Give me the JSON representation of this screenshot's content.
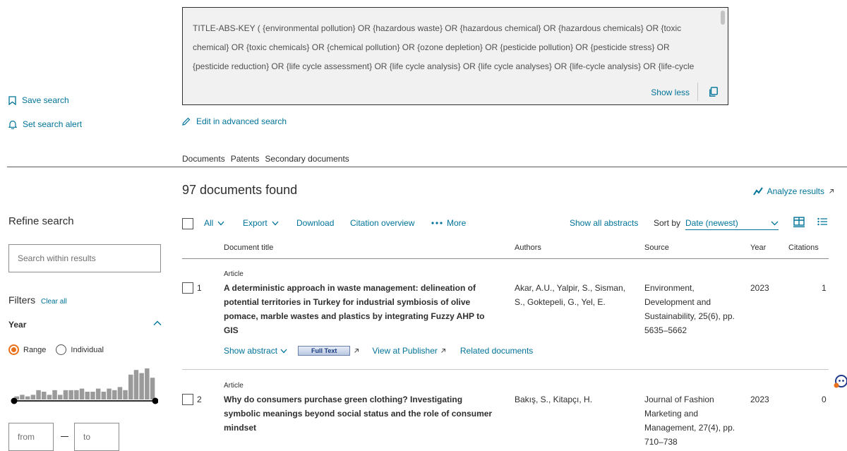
{
  "query": {
    "text": "TITLE-ABS-KEY ( {environmental pollution} OR {hazardous waste} OR {hazardous chemical} OR {hazardous chemicals} OR {toxic chemical} OR {toxic chemicals} OR {chemical pollution} OR {ozone depletion} OR {pesticide pollution} OR {pesticide stress} OR {pesticide reduction} OR {life cycle assessment} OR {life cycle analysis} OR {life cycle analyses} OR {life-cycle analysis} OR {life-cycle",
    "show_less": "Show less",
    "edit_label": "Edit in advanced search"
  },
  "sidebar": {
    "save_search": "Save search",
    "set_alert": "Set search alert",
    "refine_title": "Refine search",
    "search_placeholder": "Search within results",
    "filters_title": "Filters",
    "clear_all": "Clear all",
    "year_label": "Year",
    "range_label": "Range",
    "individual_label": "Individual",
    "histogram_values": [
      1,
      1.5,
      1,
      1.5,
      3,
      2.5,
      1.5,
      3,
      1.5,
      3,
      3,
      3,
      3.5,
      2.5,
      2.5,
      3.5,
      2.5,
      3.5,
      3,
      4,
      3,
      8,
      9.5,
      8.5,
      10,
      7
    ],
    "from_placeholder": "from",
    "to_placeholder": "to"
  },
  "tabs": [
    "Documents",
    "Patents",
    "Secondary documents"
  ],
  "results": {
    "count_label": "97 documents found",
    "analyze": "Analyze results",
    "toolbar": {
      "all": "All",
      "export": "Export",
      "download": "Download",
      "citation_overview": "Citation overview",
      "more": "More",
      "show_all_abstracts": "Show all abstracts",
      "sort_by": "Sort by",
      "sort_value": "Date (newest)"
    },
    "columns": {
      "title": "Document title",
      "authors": "Authors",
      "source": "Source",
      "year": "Year",
      "citations": "Citations"
    },
    "rows": [
      {
        "num": "1",
        "type": "Article",
        "title": "A deterministic approach in waste management: delineation of potential territories in Turkey for industrial symbiosis of olive pomace, marble wastes and plastics by integrating Fuzzy AHP to GIS",
        "authors": "Akar, A.U., Yalpir, S., Sisman, S., Goktepeli, G., Yel, E.",
        "source": "Environment, Development and Sustainability, 25(6), pp. 5635–5662",
        "year": "2023",
        "citations": "1",
        "show_abstract": "Show abstract",
        "full_text": "Full Text",
        "view_publisher": "View at Publisher",
        "related": "Related documents"
      },
      {
        "num": "2",
        "type": "Article",
        "title": "Why do consumers purchase green clothing? Investigating symbolic meanings beyond social status and the role of consumer mindset",
        "authors": "Bakış, S., Kitapçı, H.",
        "source": "Journal of Fashion Marketing and Management, 27(4), pp. 710–738",
        "year": "2023",
        "citations": "0"
      }
    ]
  },
  "colors": {
    "accent": "#007398",
    "radio_accent": "#e9711c",
    "histogram_bar": "#9a9a9a",
    "query_bg": "#f1f1f1"
  }
}
